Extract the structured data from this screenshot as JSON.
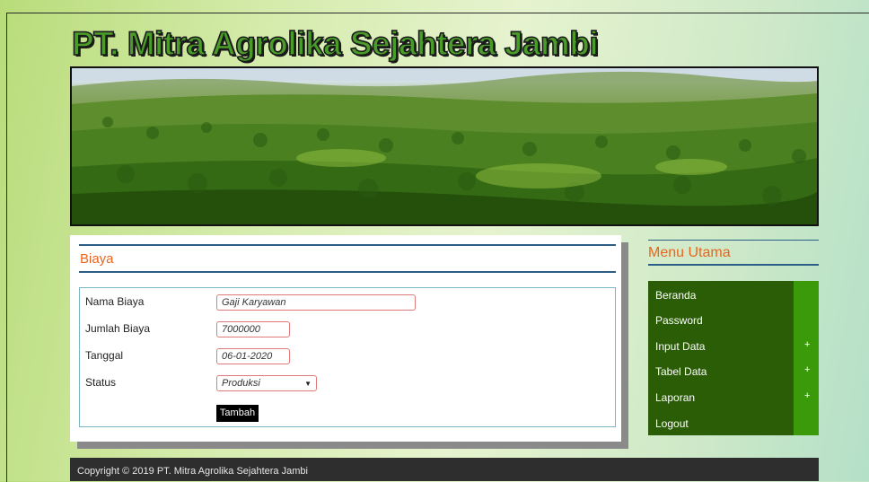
{
  "site": {
    "title": "PT. Mitra Agrolika Sejahtera Jambi"
  },
  "main": {
    "section_title": "Biaya",
    "form": {
      "fields": [
        {
          "label": "Nama Biaya",
          "value": "Gaji Karyawan"
        },
        {
          "label": "Jumlah Biaya",
          "value": "7000000"
        },
        {
          "label": "Tanggal",
          "value": "06-01-2020"
        },
        {
          "label": "Status",
          "value": "Produksi"
        }
      ],
      "submit_label": "Tambah"
    }
  },
  "sidebar": {
    "title": "Menu Utama",
    "items": [
      {
        "label": "Beranda",
        "expand": ""
      },
      {
        "label": "Password",
        "expand": ""
      },
      {
        "label": "Input Data",
        "expand": "+"
      },
      {
        "label": "Tabel Data",
        "expand": "+"
      },
      {
        "label": "Laporan",
        "expand": "+"
      },
      {
        "label": "Logout",
        "expand": ""
      }
    ]
  },
  "footer": {
    "text": "Copyright © 2019 PT. Mitra Agrolika Sejahtera Jambi"
  },
  "colors": {
    "accent_orange": "#e8651f",
    "menu_dark_green": "#2a5d06",
    "menu_bright_green": "#3b9a0a",
    "rule_blue": "#2b5f87",
    "footer_bg": "#2e2e2e"
  }
}
